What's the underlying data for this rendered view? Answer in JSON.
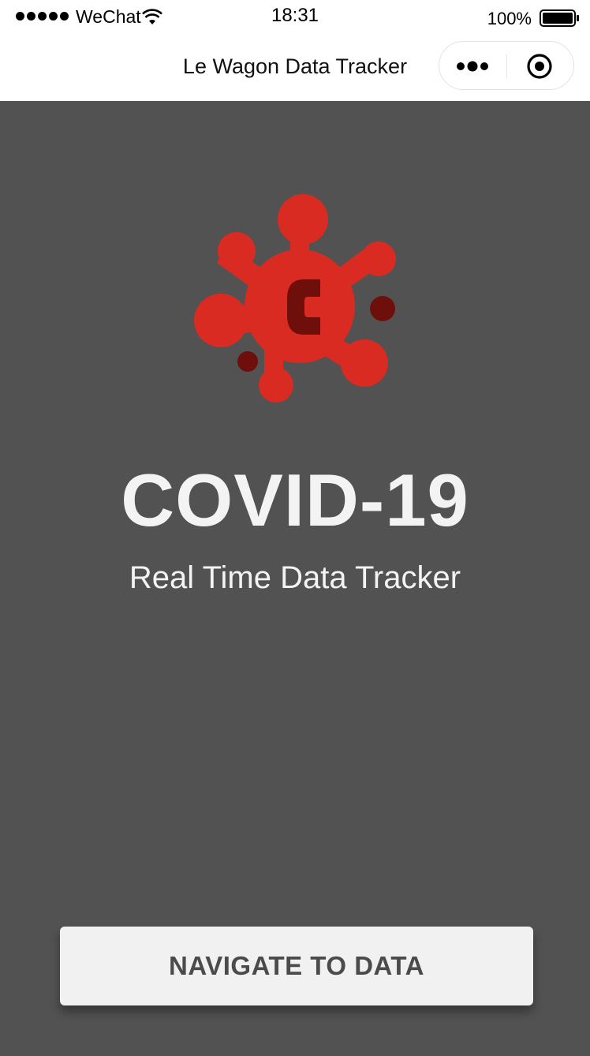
{
  "status_bar": {
    "carrier": "WeChat",
    "time": "18:31",
    "battery_percent": "100%",
    "signal_icon": "signal-dots-icon",
    "wifi_icon": "wifi-icon",
    "battery_icon": "battery-icon"
  },
  "nav_bar": {
    "title": "Le Wagon Data Tracker",
    "more_icon": "more-dots-icon",
    "close_icon": "target-close-icon"
  },
  "main": {
    "logo_icon": "virus-logo-icon",
    "logo_letter": "C",
    "headline": "COVID-19",
    "subtitle": "Real Time Data Tracker",
    "cta_label": "NAVIGATE TO DATA"
  },
  "colors": {
    "background": "#525252",
    "logo_red": "#d92b22",
    "logo_dark": "#6e0f0c",
    "text_light": "#f3f3f3",
    "button_bg": "#f1f1f1",
    "button_text": "#4b4b4b"
  }
}
